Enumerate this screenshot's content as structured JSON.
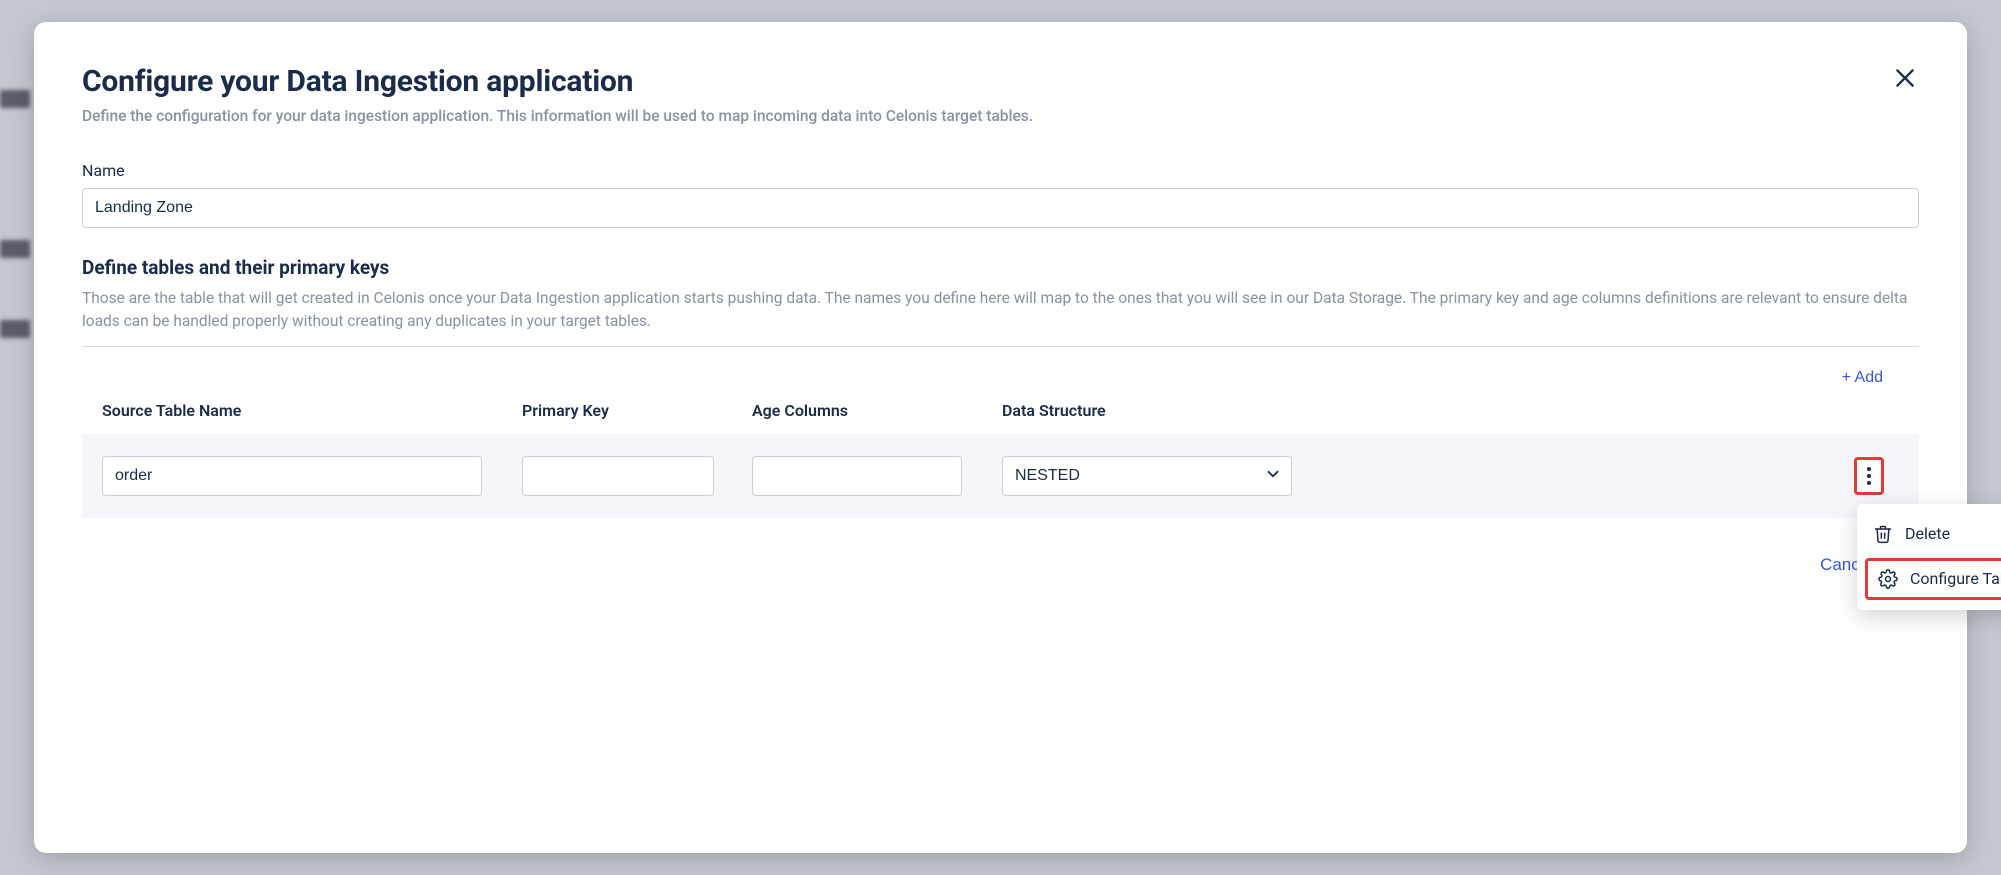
{
  "modal": {
    "title": "Configure your Data Ingestion application",
    "subtitle": "Define the configuration for your data ingestion application. This information will be used to map incoming data into Celonis target tables."
  },
  "name_field": {
    "label": "Name",
    "value": "Landing Zone"
  },
  "tables_section": {
    "title": "Define tables and their primary keys",
    "desc": "Those are the table that will get created in Celonis once your Data Ingestion application starts pushing data. The names you define here will map to the ones that you will see in our Data Storage. The primary key and age columns definitions are relevant to ensure delta loads can be handled properly without creating any duplicates in your target tables.",
    "add_label": "+ Add",
    "headers": {
      "source": "Source Table Name",
      "pk": "Primary Key",
      "age": "Age Columns",
      "ds": "Data Structure"
    },
    "row": {
      "source": "order",
      "pk": "",
      "age": "",
      "ds": "NESTED"
    }
  },
  "dropdown": {
    "delete": "Delete",
    "configure": "Configure Table Schema"
  },
  "footer": {
    "cancel": "Cancel"
  }
}
